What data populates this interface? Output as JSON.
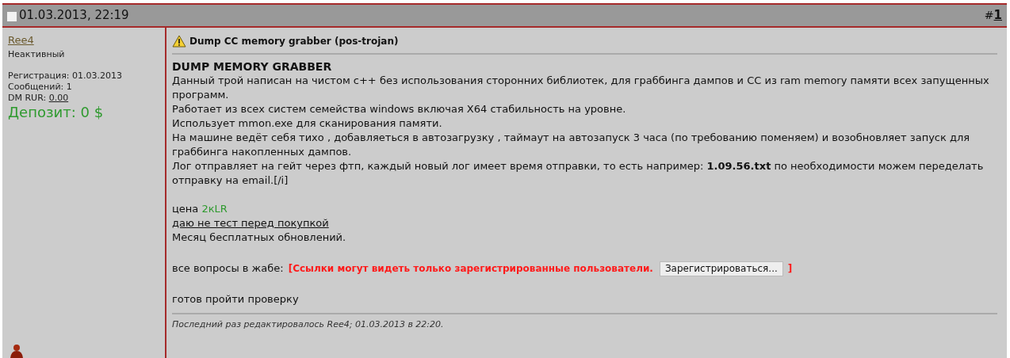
{
  "header": {
    "date": "01.03.2013, 22:19",
    "post_prefix": "#",
    "post_number": "1"
  },
  "user": {
    "name": "Ree4",
    "status": "Неактивный",
    "stats": [
      {
        "label": "Регистрация:",
        "value": "01.03.2013",
        "kind": "text"
      },
      {
        "label": "Сообщений:",
        "value": "1",
        "kind": "text"
      },
      {
        "label": "DM RUR:",
        "value": "0.00",
        "kind": "link"
      }
    ],
    "deposit": "Депозит: 0 $"
  },
  "post": {
    "title": "Dump CC memory grabber (pos-trojan)",
    "heading": "DUMP MEMORY GRABBER",
    "paragraphs": [
      "Данный трой написан на чистом c++ без использования сторонних библиотек, для граббинга дампов и CC из ram memory памяти всех запущенных программ.",
      "Работает из всех систем семейства windows включая X64 стабильность на уровне.",
      "Использует mmon.exe для сканирования памяти.",
      "На машине ведёт себя тихо , добавляеться в автозагрузку , таймаут на автозапуск 3 часа (по требованию поменяем) и возобновляет запуск для граббинга накопленных дампов.",
      "Лог отправляет на гейт через фтп, каждый новый лог имеет время отправки, то есть например: **1.09.56.txt** по необходимости можем переделать отправку на email.[/i]"
    ],
    "price": {
      "label": "цена",
      "value": "2кLR"
    },
    "test_note": "даю не тест перед покупкой",
    "updates": "Месяц бесплатных обновлений.",
    "contact": {
      "label": "все вопросы в жабе:",
      "notice": "[Ссылки могут видеть только зарегистрированные пользователи.",
      "button": "Зарегистрироваться...",
      "closing": "]"
    },
    "check": "готов пройти проверку",
    "edit_note": "Последний раз редактировалось Ree4; 01.03.2013 в 22:20."
  }
}
